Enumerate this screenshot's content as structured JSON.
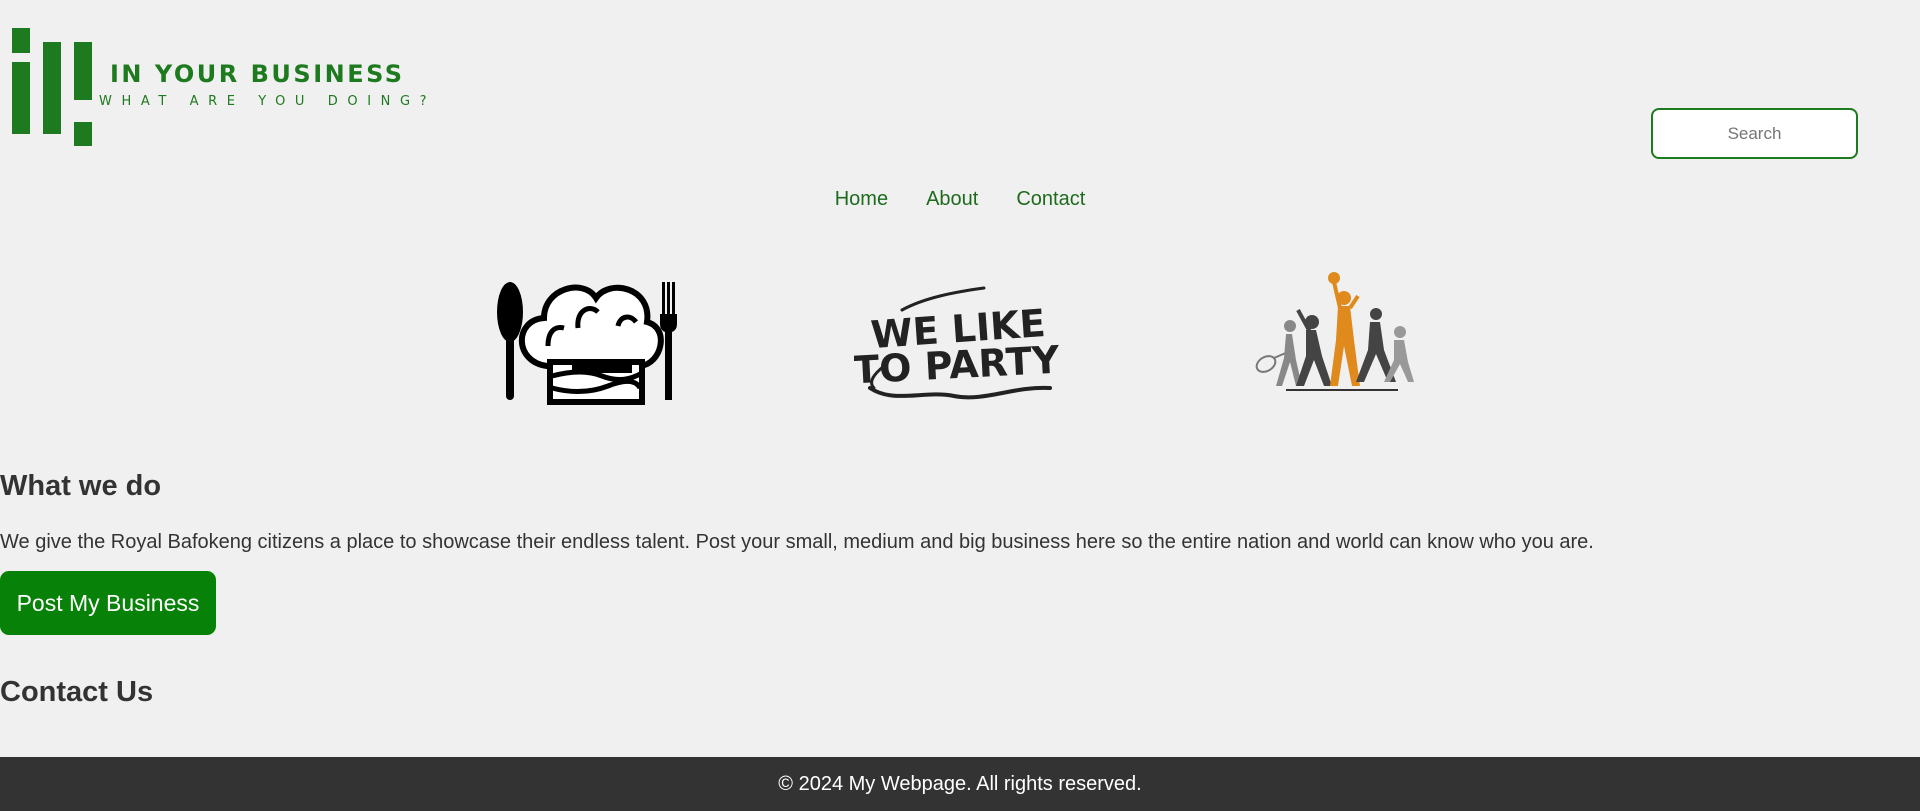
{
  "logo": {
    "title": "IN YOUR BUSINESS",
    "tagline": "WHAT ARE YOU DOING?",
    "brand_color": "#1e7a1e"
  },
  "search": {
    "placeholder": "Search",
    "value": ""
  },
  "nav": {
    "items": [
      {
        "label": "Home"
      },
      {
        "label": "About"
      },
      {
        "label": "Contact"
      }
    ]
  },
  "gallery": {
    "images": [
      {
        "icon": "chef-hat-cutlery-icon"
      },
      {
        "icon": "we-like-to-party-logo",
        "text": "WE LIKE TO PARTY"
      },
      {
        "icon": "sports-figures-icon"
      }
    ]
  },
  "main": {
    "what_heading": "What we do",
    "description": "We give the Royal Bafokeng citizens a place to showcase their endless talent. Post your small, medium and big business here so the entire nation and world can know who you are.",
    "post_button": "Post My Business",
    "contact_heading": "Contact Us"
  },
  "footer": {
    "text": "© 2024 My Webpage. All rights reserved."
  },
  "colors": {
    "background": "#f0f0f0",
    "accent": "#078107",
    "footer_bg": "#333333",
    "text": "#333333"
  }
}
